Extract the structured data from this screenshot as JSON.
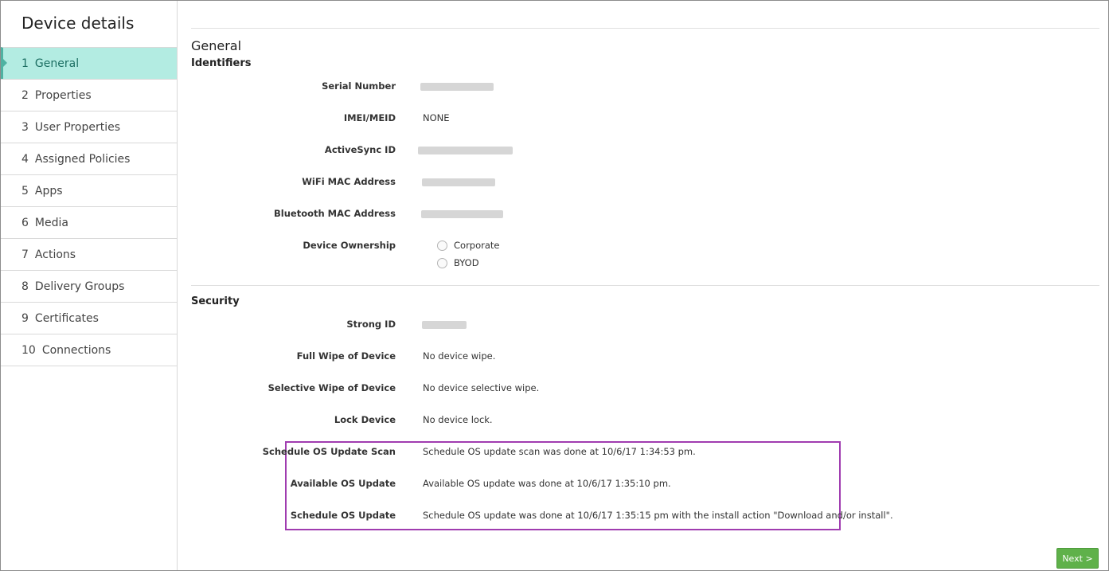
{
  "sidebar": {
    "title": "Device details",
    "items": [
      {
        "num": "1",
        "label": "General",
        "active": true
      },
      {
        "num": "2",
        "label": "Properties"
      },
      {
        "num": "3",
        "label": "User Properties"
      },
      {
        "num": "4",
        "label": "Assigned Policies"
      },
      {
        "num": "5",
        "label": "Apps"
      },
      {
        "num": "6",
        "label": "Media"
      },
      {
        "num": "7",
        "label": "Actions"
      },
      {
        "num": "8",
        "label": "Delivery Groups"
      },
      {
        "num": "9",
        "label": "Certificates"
      },
      {
        "num": "10",
        "label": "Connections"
      }
    ]
  },
  "main": {
    "title": "General",
    "identifiers": {
      "heading": "Identifiers",
      "serial_label": "Serial Number",
      "imei_label": "IMEI/MEID",
      "imei_value": "NONE",
      "activesync_label": "ActiveSync ID",
      "wifi_label": "WiFi MAC Address",
      "bluetooth_label": "Bluetooth MAC Address",
      "ownership_label": "Device Ownership",
      "ownership_options": [
        "Corporate",
        "BYOD"
      ]
    },
    "security": {
      "heading": "Security",
      "strong_label": "Strong ID",
      "full_wipe_label": "Full Wipe of Device",
      "full_wipe_value": "No device wipe.",
      "selective_wipe_label": "Selective Wipe of Device",
      "selective_wipe_value": "No device selective wipe.",
      "lock_label": "Lock Device",
      "lock_value": "No device lock.",
      "scan_label": "Schedule OS Update Scan",
      "scan_value": "Schedule OS update scan was done at 10/6/17 1:34:53 pm.",
      "available_label": "Available OS Update",
      "available_value": "Available OS update was done at 10/6/17 1:35:10 pm.",
      "schedule_label": "Schedule OS Update",
      "schedule_value": "Schedule OS update was done at 10/6/17 1:35:15 pm with the install action \"Download and/or install\"."
    },
    "next_label": "Next >"
  }
}
